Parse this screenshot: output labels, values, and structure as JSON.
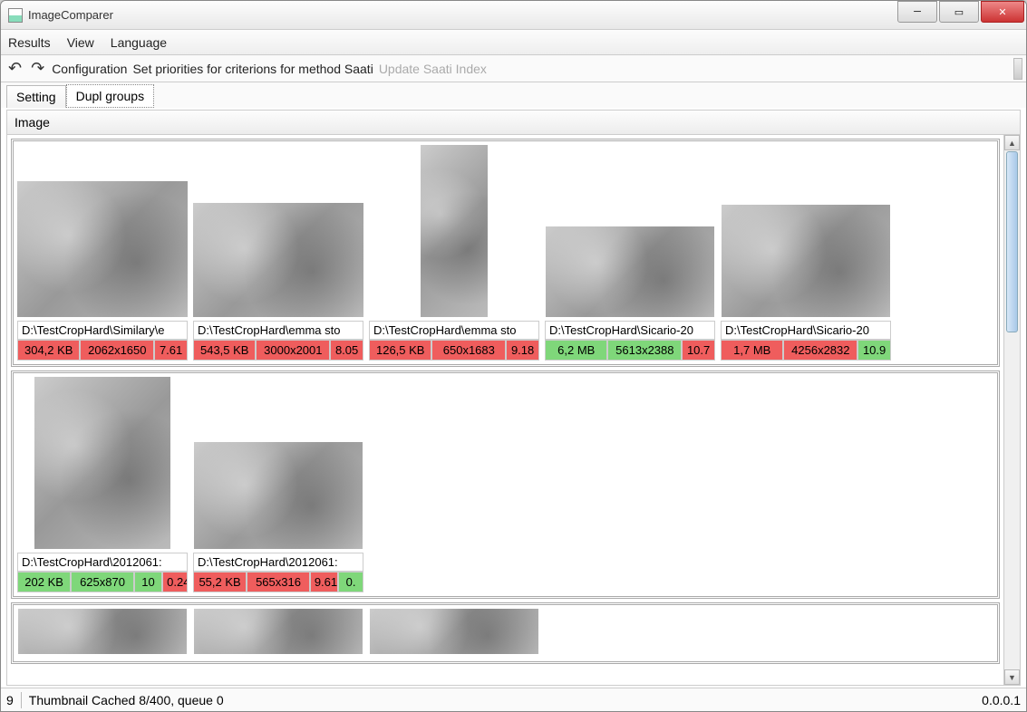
{
  "window": {
    "title": "ImageComparer"
  },
  "menu": {
    "results": "Results",
    "view": "View",
    "language": "Language"
  },
  "toolbar": {
    "configuration": "Configuration",
    "set_priorities": "Set priorities for criterions for method Saati",
    "update_index": "Update Saati Index"
  },
  "tabs": {
    "setting": "Setting",
    "dupl_groups": "Dupl groups"
  },
  "column_header": "Image",
  "colors": {
    "good": "#7fd77a",
    "bad": "#ef5d5d"
  },
  "groups": [
    {
      "items": [
        {
          "thumb_w": 188,
          "thumb_h": 150,
          "path": "D:\\TestCropHard\\Similary\\e",
          "size": "304,2 KB",
          "dims": "2062x1650",
          "score": "7.61",
          "size_cls": "bad",
          "dims_cls": "bad",
          "score_cls": "bad"
        },
        {
          "thumb_w": 188,
          "thumb_h": 126,
          "path": "D:\\TestCropHard\\emma sto",
          "size": "543,5 KB",
          "dims": "3000x2001",
          "score": "8.05",
          "size_cls": "bad",
          "dims_cls": "bad",
          "score_cls": "bad"
        },
        {
          "thumb_w": 74,
          "thumb_h": 190,
          "path": "D:\\TestCropHard\\emma sto",
          "size": "126,5 KB",
          "dims": "650x1683",
          "score": "9.18",
          "size_cls": "bad",
          "dims_cls": "bad",
          "score_cls": "bad"
        },
        {
          "thumb_w": 186,
          "thumb_h": 100,
          "path": "D:\\TestCropHard\\Sicario-20",
          "size": "6,2 MB",
          "dims": "5613x2388",
          "score": "10.7",
          "size_cls": "good",
          "dims_cls": "good",
          "score_cls": "bad"
        },
        {
          "thumb_w": 186,
          "thumb_h": 124,
          "path": "D:\\TestCropHard\\Sicario-20",
          "size": "1,7 MB",
          "dims": "4256x2832",
          "score": "10.9",
          "size_cls": "bad",
          "dims_cls": "bad",
          "score_cls": "good"
        }
      ]
    },
    {
      "items": [
        {
          "thumb_w": 150,
          "thumb_h": 190,
          "path": "D:\\TestCropHard\\2012061:",
          "size": "202 KB",
          "dims": "625x870",
          "score": "10",
          "extra": "0.24",
          "size_cls": "good",
          "dims_cls": "good",
          "score_cls": "good",
          "extra_cls": "bad"
        },
        {
          "thumb_w": 186,
          "thumb_h": 118,
          "path": "D:\\TestCropHard\\2012061:",
          "size": "55,2 KB",
          "dims": "565x316",
          "score": "9.61",
          "extra": "0.",
          "size_cls": "bad",
          "dims_cls": "bad",
          "score_cls": "bad",
          "extra_cls": "good"
        }
      ]
    },
    {
      "items": [
        {
          "thumb_w": 186,
          "thumb_h": 50,
          "path": "",
          "partial": true
        },
        {
          "thumb_w": 186,
          "thumb_h": 50,
          "path": "",
          "partial": true
        },
        {
          "thumb_w": 186,
          "thumb_h": 50,
          "path": "",
          "partial": true
        }
      ]
    }
  ],
  "status": {
    "left_num": "9",
    "cache": "Thumbnail Cached 8/400, queue 0",
    "version": "0.0.0.1"
  }
}
